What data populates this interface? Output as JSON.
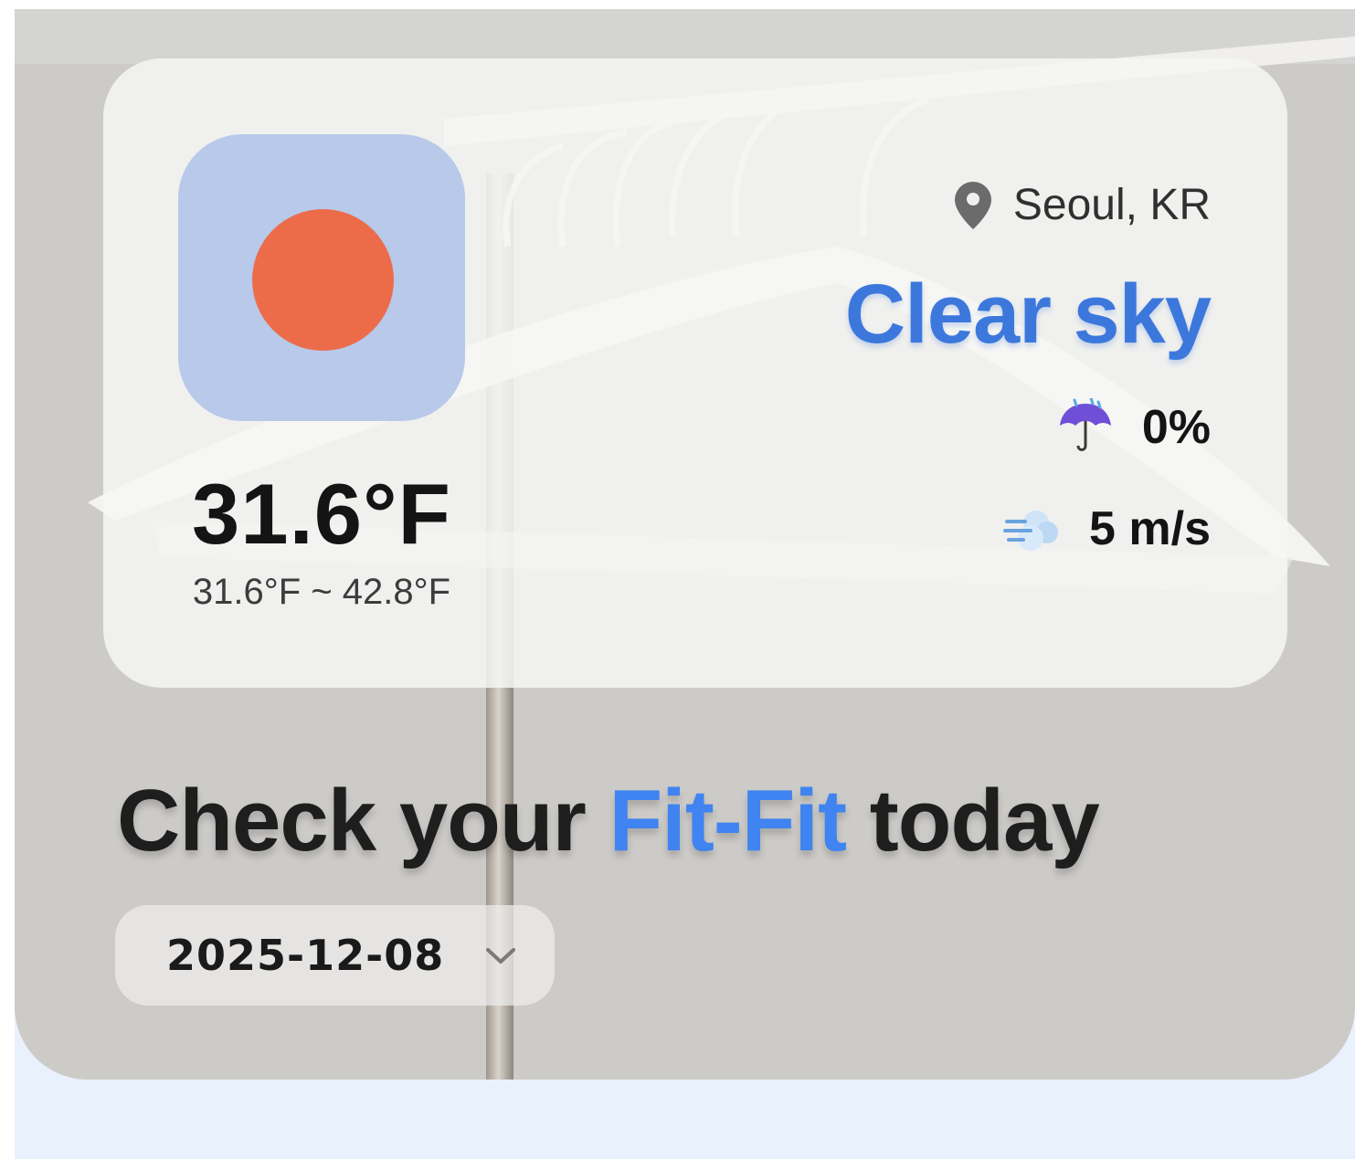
{
  "weather": {
    "location": "Seoul, KR",
    "condition": "Clear sky",
    "temperature": "31.6°F",
    "temperature_range": "31.6°F ~ 42.8°F",
    "precipitation": "0%",
    "wind": "5 m/s",
    "icon": "sun-circle-icon",
    "precip_icon": "umbrella-rain-icon",
    "wind_icon": "wind-gust-icon",
    "location_icon": "location-pin-icon"
  },
  "headline": {
    "prefix": "Check your",
    "brand": "Fit-Fit",
    "suffix": "today"
  },
  "date_picker": {
    "selected": "2025-12-08",
    "icon": "chevron-down-icon"
  },
  "colors": {
    "accent": "#3f84f0",
    "condition": "#3c78dc",
    "sun": "#ec6c4a",
    "icon_tile": "#b8c9ea",
    "page_bg": "#e9f1fd"
  }
}
